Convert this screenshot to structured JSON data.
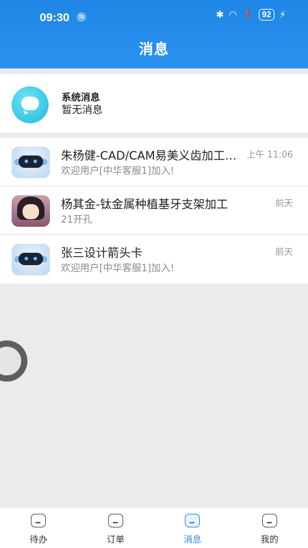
{
  "status_bar": {
    "time": "09:30",
    "battery": "92",
    "badge": "⇆"
  },
  "header": {
    "title": "消息"
  },
  "system_message": {
    "title": "系统消息",
    "subtitle": "暂无消息"
  },
  "conversations": [
    {
      "name": "朱杨健-CAD/CAM易美义齿加工中心",
      "preview": "欢迎用户[中华客服1]加入!",
      "time": "上午 11:06",
      "avatar": "robot"
    },
    {
      "name": "杨其金-钛金属种植基牙支架加工",
      "preview": "21开孔",
      "time": "前天",
      "avatar": "anime-girl"
    },
    {
      "name": "张三设计箭头卡",
      "preview": "欢迎用户[中华客服1]加入!",
      "time": "前天",
      "avatar": "robot"
    }
  ],
  "tabbar": {
    "tabs": [
      {
        "label": "待办"
      },
      {
        "label": "订单"
      },
      {
        "label": "消息",
        "active": true
      },
      {
        "label": "我的"
      }
    ]
  },
  "colors": {
    "primary": "#2a8be8",
    "background": "#ebebed"
  }
}
